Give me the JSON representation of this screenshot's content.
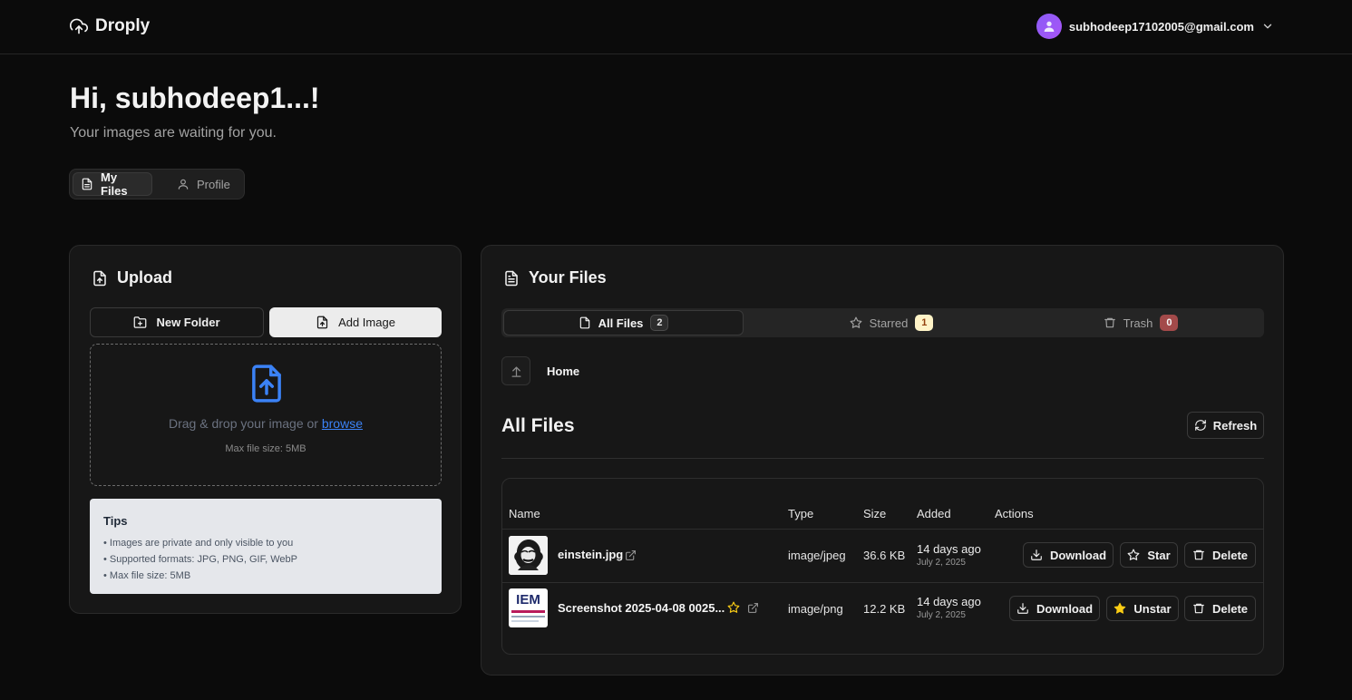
{
  "header": {
    "brand": "Droply",
    "user_email": "subhodeep17102005@gmail.com"
  },
  "greeting": {
    "title": "Hi, subhodeep1...!",
    "subtitle": "Your images are waiting for you."
  },
  "main_tabs": [
    {
      "label": "My Files",
      "active": true
    },
    {
      "label": "Profile",
      "active": false
    }
  ],
  "upload": {
    "title": "Upload",
    "new_folder_label": "New Folder",
    "add_image_label": "Add Image",
    "drop_text": "Drag & drop your image or",
    "browse_label": "browse",
    "max_size": "Max file size: 5MB",
    "tips_title": "Tips",
    "tips": [
      "• Images are private and only visible to you",
      "• Supported formats: JPG, PNG, GIF, WebP",
      "• Max file size: 5MB"
    ]
  },
  "files": {
    "title": "Your Files",
    "tabs": [
      {
        "label": "All Files",
        "count": "2"
      },
      {
        "label": "Starred",
        "count": "1"
      },
      {
        "label": "Trash",
        "count": "0"
      }
    ],
    "breadcrumb": "Home",
    "section_title": "All Files",
    "refresh_label": "Refresh",
    "columns": [
      "Name",
      "Type",
      "Size",
      "Added",
      "Actions"
    ],
    "rows": [
      {
        "name": "einstein.jpg",
        "type": "image/jpeg",
        "size": "36.6 KB",
        "added": "14 days ago",
        "date": "July 2, 2025",
        "starred": false,
        "download_label": "Download",
        "star_label": "Star",
        "delete_label": "Delete"
      },
      {
        "name": "Screenshot 2025-04-08 0025...",
        "type": "image/png",
        "size": "12.2 KB",
        "added": "14 days ago",
        "date": "July 2, 2025",
        "starred": true,
        "thumb_text": "IEM",
        "download_label": "Download",
        "star_label": "Unstar",
        "delete_label": "Delete"
      }
    ]
  },
  "colors": {
    "background": "#0b0b0b",
    "card": "#171717",
    "accent_blue": "#3b82f6",
    "star_yellow": "#facc15",
    "avatar_purple": "#8b5cf6",
    "trash_badge": "#a34a4a"
  }
}
